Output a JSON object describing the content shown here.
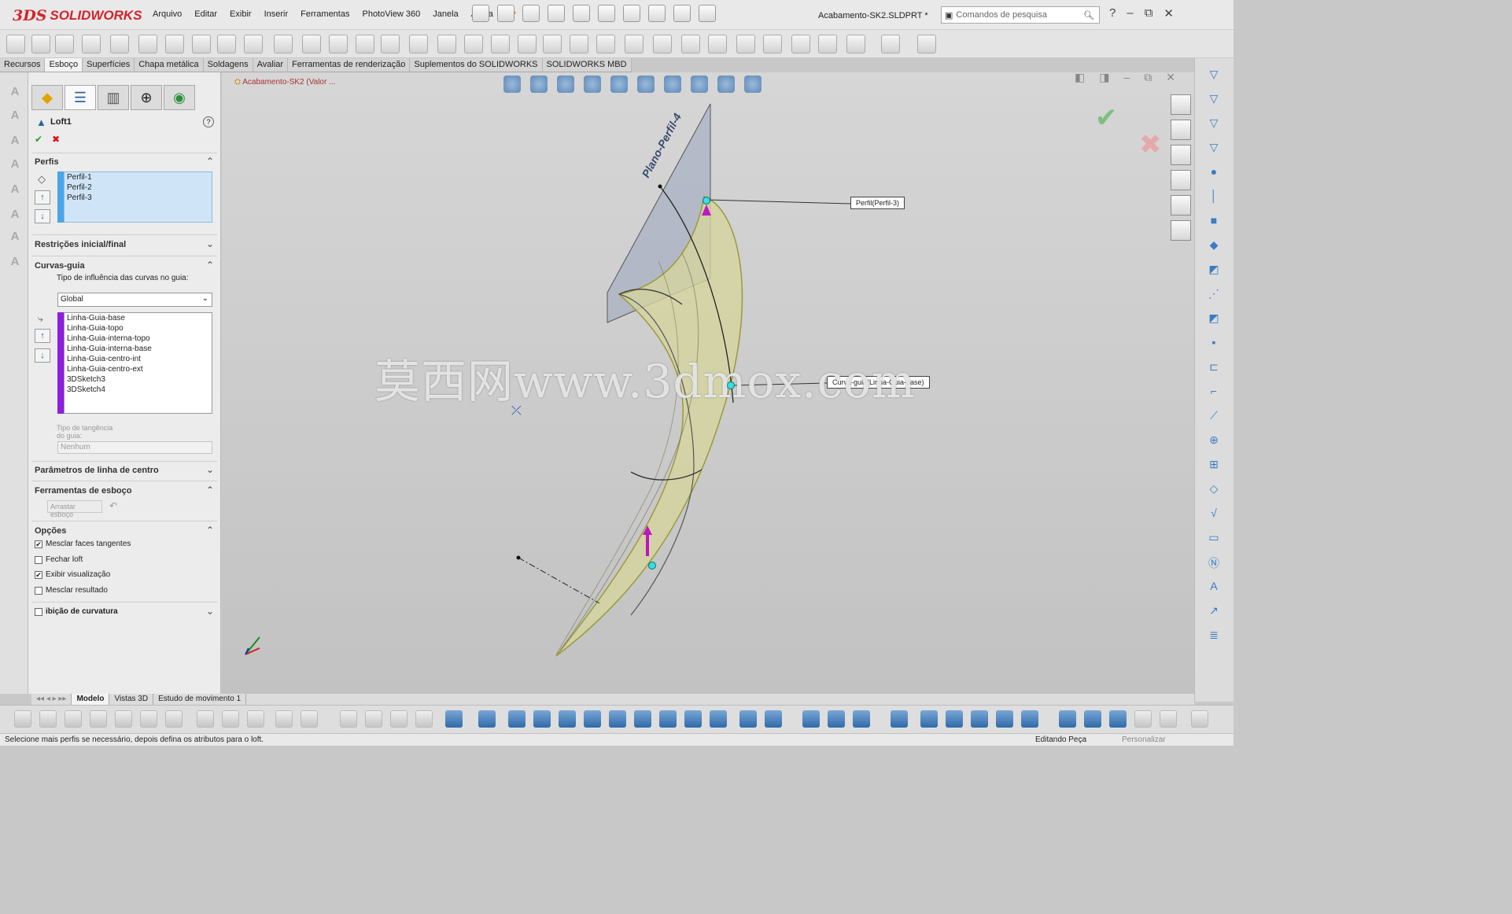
{
  "app": {
    "brand": "SOLIDWORKS",
    "brand_mark": "3DS"
  },
  "menu": [
    "Arquivo",
    "Editar",
    "Exibir",
    "Inserir",
    "Ferramentas",
    "PhotoView 360",
    "Janela",
    "Ajuda"
  ],
  "doc_title": "Acabamento-SK2.SLDPRT *",
  "search": {
    "placeholder": "Comandos de pesquisa"
  },
  "window_controls": [
    "?",
    "–",
    "⧉",
    "✕"
  ],
  "cm_tabs": [
    "Recursos",
    "Esboço",
    "Superfícies",
    "Chapa metálica",
    "Soldagens",
    "Avaliar",
    "Ferramentas de renderização",
    "Suplementos do SOLIDWORKS",
    "SOLIDWORKS MBD"
  ],
  "cm_active": "Esboço",
  "tree_breadcrumb": "Acabamento-SK2  (Valor ...",
  "pm": {
    "title": "Loft1",
    "help": "?",
    "ok": "✔",
    "cancel": "✖",
    "profiles_header": "Perfis",
    "profiles": [
      "Perfil-1",
      "Perfil-2",
      "Perfil-3"
    ],
    "start_end_header": "Restrições inicial/final",
    "guides_header": "Curvas-guia",
    "influence_label": "Tipo de influência das curvas no guia:",
    "influence_value": "Global",
    "guides": [
      "Linha-Guia-base",
      "Linha-Guia-topo",
      "Linha-Guia-interna-topo",
      "Linha-Guia-interna-base",
      "Linha-Guia-centro-int",
      "Linha-Guia-centro-ext",
      "3DSketch3",
      "3DSketch4"
    ],
    "tangency_label": "Tipo de tangência do guia:",
    "tangency_value": "Nenhum",
    "centerline_header": "Parâmetros de linha de centro",
    "sketch_tools_header": "Ferramentas de esboço",
    "drag_sketch": "Arrastar esboço",
    "options_header": "Opções",
    "options": [
      {
        "label": "Mesclar faces tangentes",
        "checked": true
      },
      {
        "label": "Fechar loft",
        "checked": false
      },
      {
        "label": "Exibir visualização",
        "checked": true
      },
      {
        "label": "Mesclar resultado",
        "checked": false
      }
    ],
    "curvature_header": "ibição de curvatura"
  },
  "callouts": {
    "profile": "Perfil(Perfil-3)",
    "guide": "Curva-guia(Linha-Guia-base)"
  },
  "plane_label": "Plano-Perfil-4",
  "watermark": "莫西网www.3dmox.com",
  "bottom_tabs": [
    "Modelo",
    "Vistas 3D",
    "Estudo de movimento 1"
  ],
  "bottom_active": "Modelo",
  "status": {
    "message": "Selecione mais perfis se necessário, depois defina os atributos para o loft.",
    "mode": "Editando Peça",
    "customize": "Personalizar"
  },
  "accent": "#d5232b"
}
